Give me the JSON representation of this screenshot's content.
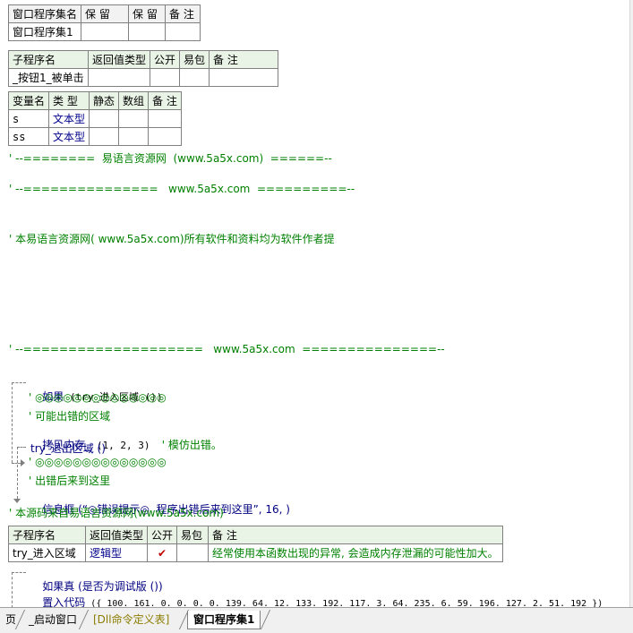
{
  "assembly_table": {
    "headers": [
      "窗口程序集名",
      "保 留",
      "保 留",
      "备 注"
    ],
    "row": [
      "窗口程序集1",
      "",
      "",
      ""
    ]
  },
  "sub1_table": {
    "headers": [
      "子程序名",
      "返回值类型",
      "公开",
      "易包",
      "备 注"
    ],
    "row": [
      "_按钮1_被单击",
      "",
      "",
      "",
      ""
    ]
  },
  "var_table": {
    "headers": [
      "变量名",
      "类 型",
      "静态",
      "数组",
      "备 注"
    ],
    "rows": [
      [
        "s",
        "文本型",
        "",
        "",
        ""
      ],
      [
        "ss",
        "文本型",
        "",
        "",
        ""
      ]
    ]
  },
  "code": {
    "c1": "' --========  易语言资源网  (www.5a5x.com)  ======--",
    "c2": "' --===============   www.5a5x.com  ==========--",
    "c3": "' 本易语言资源网( www.5a5x.com)所有软件和资料均为软件作者提",
    "c4": "' --====================   www.5a5x.com  ===============--",
    "if_kw": "如果",
    "if_cond": " (try_进入区域 ())",
    "l1": "' ◎◎◎◎◎◎◎◎◎◎◎◎◎◎",
    "l2": "' 可能出错的区域",
    "l3a": "拷贝内存_",
    "l3b": " (1, 2, 3)  ",
    "l3c": "' 模仿出错。",
    "else_line": "try_退出区域 ()",
    "l4": "' ◎◎◎◎◎◎◎◎◎◎◎◎◎◎",
    "l5": "' 出错后来到这里",
    "l6a": "信息框",
    "l6b": " (“◎错误提示◎  程序出错后来到这里”, 16, )",
    "l7": "' 本源码来自易语言资源网(www.5a5x.com)",
    "if2_kw": "如果真",
    "if2_cond": " (是否为调试版 ())",
    "l8a": "置入代码",
    "l8b": " ({ 100. 161. 0. 0. 0. 0. 139. 64. 12. 133. 192. 117. 3. 64. 235. 6. 59. 196. 127. 2. 51. 192 })"
  },
  "sub2_table": {
    "headers": [
      "子程序名",
      "返回值类型",
      "公开",
      "易包",
      "备 注"
    ],
    "row": [
      "try_进入区域",
      "逻辑型",
      "✔",
      "",
      "经常使用本函数出现的异常, 会造成内存泄漏的可能性加大。"
    ]
  },
  "tabs": [
    {
      "label": "页",
      "active": false
    },
    {
      "label": "_启动窗口",
      "active": false
    },
    {
      "label": "[Dll命令定义表]",
      "active": false
    },
    {
      "label": "窗口程序集1",
      "active": true
    }
  ],
  "colors": {
    "comment": "#008000",
    "keyword": "#000080",
    "type": "#00008b",
    "header_bg": "#eaf4e6",
    "check": "#c00000"
  }
}
